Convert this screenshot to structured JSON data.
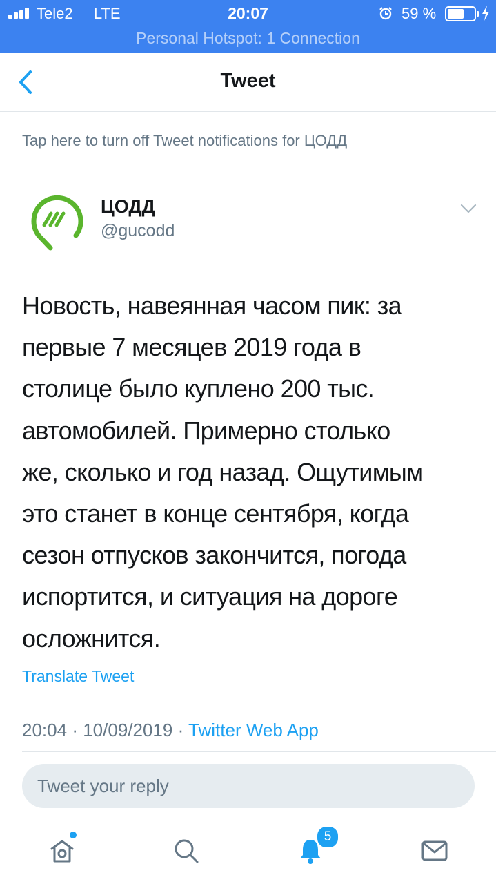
{
  "status_bar": {
    "carrier": "Tele2",
    "network": "LTE",
    "time": "20:07",
    "battery": "59 %",
    "hotspot": "Personal Hotspot: 1 Connection",
    "icons": [
      "signal-icon",
      "alarm-icon",
      "battery-icon",
      "charging-icon"
    ]
  },
  "nav": {
    "title": "Tweet",
    "back_icon": "chevron-left-icon"
  },
  "notification_toggle": "Tap here to turn off Tweet notifications for ЦОДД",
  "tweet": {
    "author_name": "ЦОДД",
    "author_handle": "@gucodd",
    "text_lines": [
      "Новость, навеянная часом пик: за",
      "первые 7 месяцев 2019 года в",
      "столице было куплено 200 тыс.",
      "автомобилей. Примерно столько",
      "же, сколько и год назад. Ощутимым",
      "это станет в конце сентября, когда",
      "сезон отпусков закончится, погода",
      "испортится, и ситуация на дороге",
      "осложнится."
    ],
    "translate_label": "Translate Tweet",
    "time": "20:04",
    "date": "10/09/2019",
    "separator": "·",
    "source": "Twitter Web App"
  },
  "reply": {
    "placeholder": "Tweet your reply"
  },
  "tab_bar": {
    "items": [
      "home-icon",
      "search-icon",
      "notifications-icon",
      "messages-icon"
    ],
    "notifications_badge": "5"
  },
  "colors": {
    "status_bar": "#3c82f0",
    "accent": "#1da1f2",
    "logo_green": "#5ab52d",
    "text": "#14171a",
    "muted": "#657786"
  }
}
